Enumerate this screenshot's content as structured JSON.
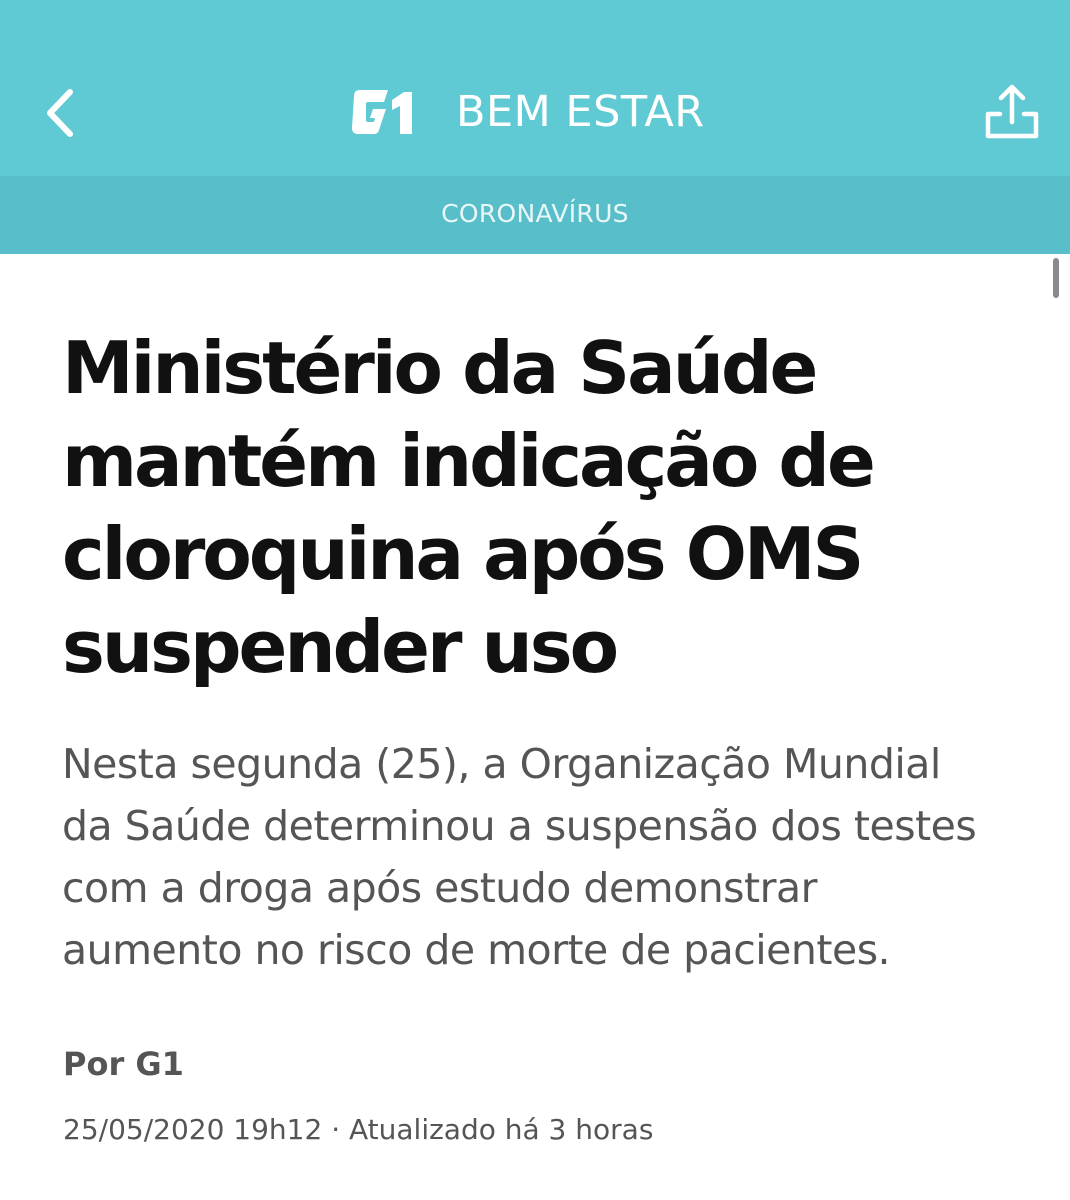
{
  "header": {
    "logo_text": "G1",
    "section_title": "BEM ESTAR",
    "back_icon": "chevron-left-icon",
    "share_icon": "share-icon",
    "background_color": "#5fcad3"
  },
  "subheader": {
    "category": "CORONAVÍRUS",
    "background_color": "#58bfca"
  },
  "article": {
    "title_lines": [
      "Ministério da Saúde",
      "mantém indicação de",
      "cloroquina após OMS",
      "suspender uso"
    ],
    "subtitle_lines": [
      "Nesta segunda (25), a Organização Mundial",
      "da Saúde determinou a suspensão dos testes",
      "com a droga após estudo demonstrar",
      "aumento no risco de morte de pacientes."
    ],
    "byline": "Por G1",
    "timestamp": "25/05/2020 19h12 · Atualizado há 3 horas"
  }
}
